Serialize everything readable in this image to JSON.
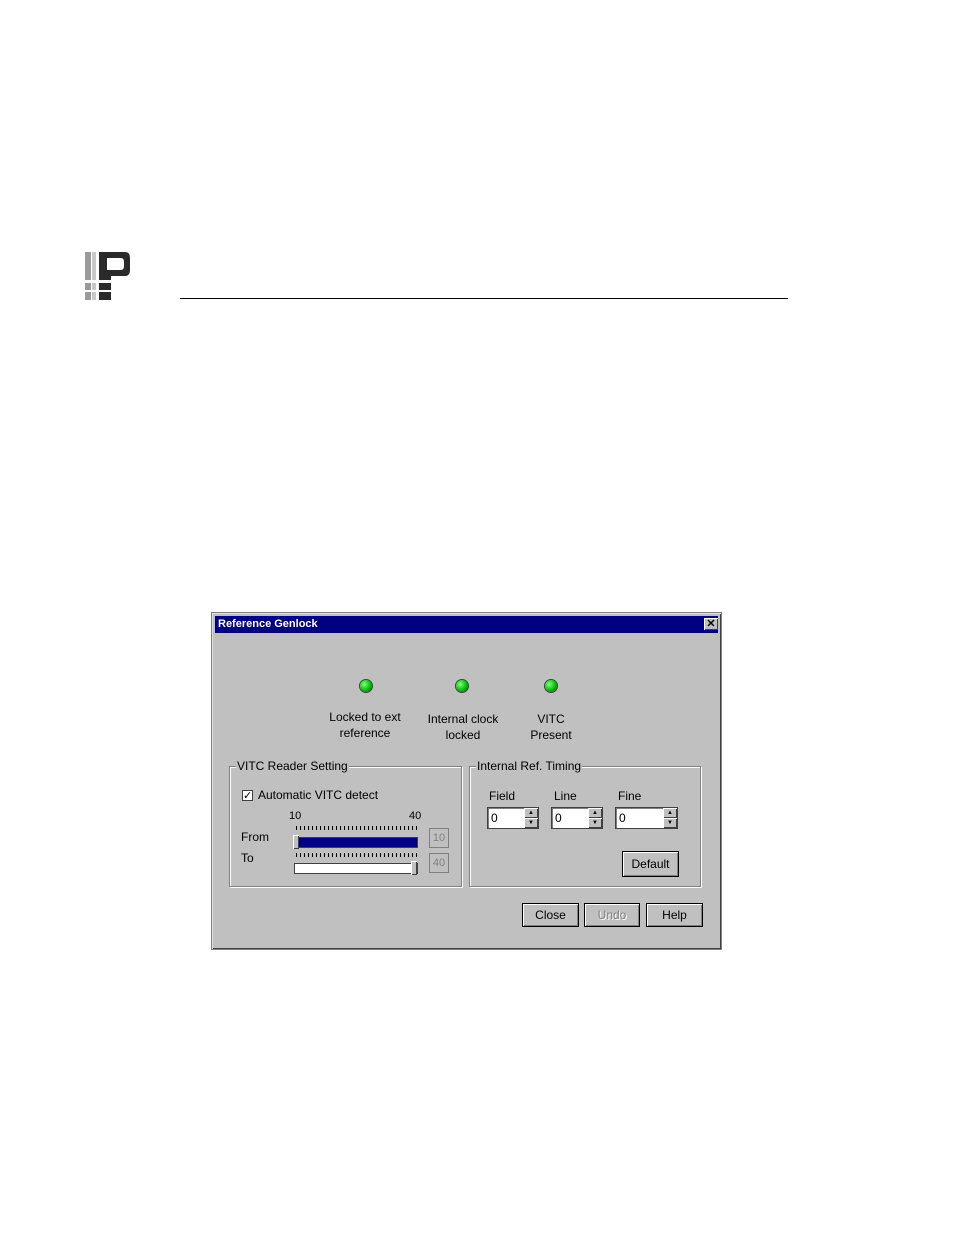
{
  "dialog": {
    "title": "Reference Genlock",
    "close_glyph": "✕",
    "status": [
      {
        "label_line1": "Locked to ext",
        "label_line2": "reference",
        "color": "#00c000"
      },
      {
        "label_line1": "Internal clock",
        "label_line2": "locked",
        "color": "#00c000"
      },
      {
        "label_line1": "VITC",
        "label_line2": "Present",
        "color": "#00c000"
      }
    ],
    "vitc_reader": {
      "title": "VITC Reader Setting",
      "auto_detect_label": "Automatic VITC detect",
      "auto_detect_checked": true,
      "check_glyph": "✓",
      "scale_min": "10",
      "scale_max": "40",
      "from_label": "From",
      "to_label": "To",
      "from_value": "10",
      "to_value": "40"
    },
    "internal_timing": {
      "title": "Internal Ref. Timing",
      "field_label": "Field",
      "line_label": "Line",
      "fine_label": "Fine",
      "field_value": "0",
      "line_value": "0",
      "fine_value": "0",
      "default_label": "Default"
    },
    "buttons": {
      "close": "Close",
      "undo": "Undo",
      "help": "Help"
    }
  }
}
